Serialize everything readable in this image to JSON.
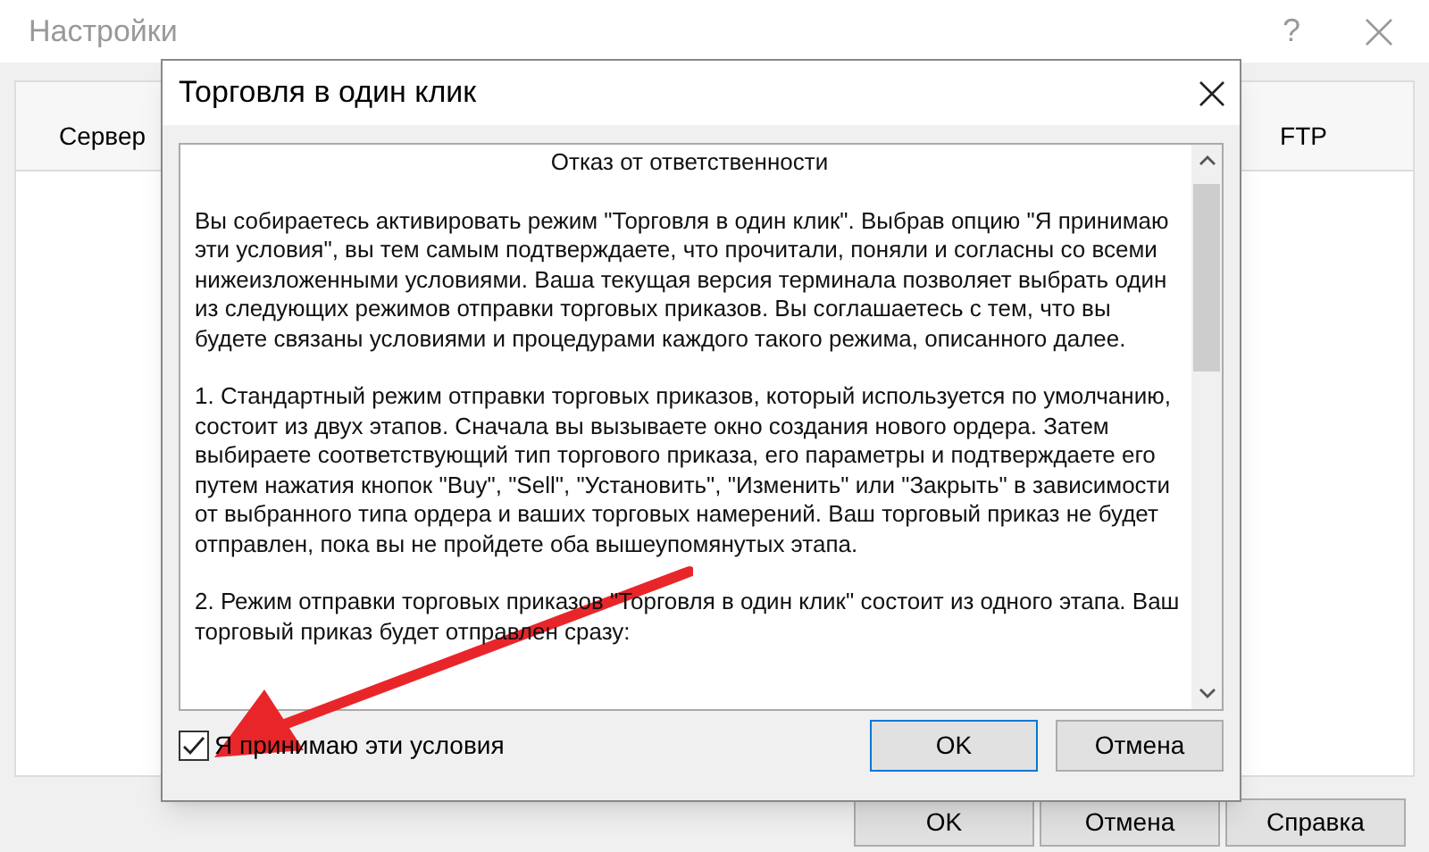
{
  "background_window": {
    "title": "Настройки",
    "help": "?",
    "columns": [
      "Сервер",
      "FTP"
    ],
    "buttons": [
      "OK",
      "Отмена",
      "Справка"
    ]
  },
  "dialog": {
    "title": "Торговля в один клик",
    "disclaimer": {
      "heading": "Отказ от ответственности",
      "paragraphs": [
        "Вы собираетесь активировать режим \"Торговля в один клик\". Выбрав опцию \"Я принимаю эти условия\", вы тем самым подтверждаете, что прочитали, поняли и согласны со всеми нижеизложенными условиями. Ваша текущая версия терминала позволяет выбрать один из следующих режимов отправки торговых приказов. Вы соглашаетесь с тем, что вы будете связаны условиями и процедурами каждого такого режима, описанного далее.",
        "1. Стандартный режим отправки торговых приказов, который используется по умолчанию, состоит из двух этапов. Сначала вы вызываете окно создания нового ордера. Затем выбираете соответствующий тип торгового приказа, его параметры и подтверждаете его путем нажатия кнопок \"Buy\", \"Sell\", \"Установить\", \"Изменить\" или \"Закрыть\" в зависимости от выбранного типа ордера и ваших торговых намерений. Ваш торговый приказ не будет отправлен, пока вы не пройдете оба вышеупомянутых этапа.",
        "2. Режим отправки торговых приказов \"Торговля в один клик\" состоит из одного этапа. Ваш торговый приказ будет отправлен сразу:"
      ]
    },
    "accept": {
      "label": "Я принимаю эти условия",
      "checked": true
    },
    "buttons": [
      "OK",
      "Отмена"
    ]
  }
}
